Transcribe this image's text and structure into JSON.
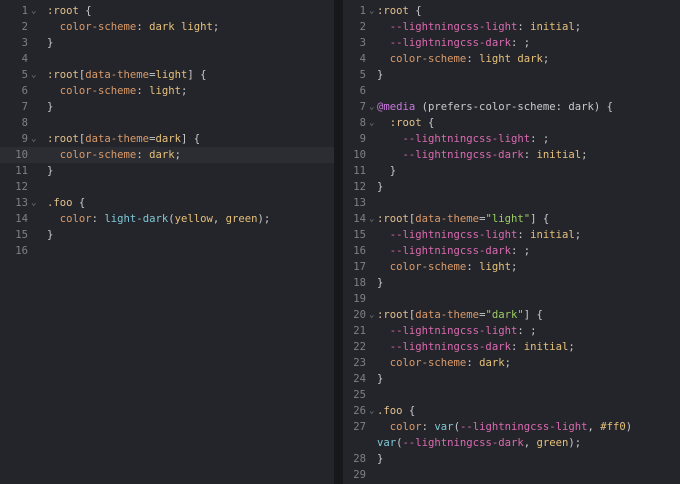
{
  "colors": {
    "background": "#24252a",
    "selector": "#e2c08d",
    "property": "#d99a6a",
    "value": "#e5c07b",
    "function": "#7fc7d7",
    "variable": "#d96ab0",
    "string": "#9ccc65",
    "at_rule": "#c678dd"
  },
  "left": {
    "lines": [
      {
        "n": "1",
        "fold": true,
        "indent": 0,
        "tokens": [
          [
            "sel",
            ":root"
          ],
          [
            "punc",
            " {"
          ]
        ]
      },
      {
        "n": "2",
        "indent": 2,
        "tokens": [
          [
            "prop",
            "color-scheme"
          ],
          [
            "punc",
            ": "
          ],
          [
            "val",
            "dark light"
          ],
          [
            "punc",
            ";"
          ]
        ]
      },
      {
        "n": "3",
        "indent": 0,
        "tokens": [
          [
            "punc",
            "}"
          ]
        ]
      },
      {
        "n": "4",
        "indent": 0,
        "tokens": []
      },
      {
        "n": "5",
        "fold": true,
        "indent": 0,
        "tokens": [
          [
            "sel",
            ":root"
          ],
          [
            "punc",
            "["
          ],
          [
            "prop",
            "data-theme"
          ],
          [
            "punc",
            "="
          ],
          [
            "val",
            "light"
          ],
          [
            "punc",
            "] {"
          ]
        ]
      },
      {
        "n": "6",
        "indent": 2,
        "tokens": [
          [
            "prop",
            "color-scheme"
          ],
          [
            "punc",
            ": "
          ],
          [
            "val",
            "light"
          ],
          [
            "punc",
            ";"
          ]
        ]
      },
      {
        "n": "7",
        "indent": 0,
        "tokens": [
          [
            "punc",
            "}"
          ]
        ]
      },
      {
        "n": "8",
        "indent": 0,
        "tokens": []
      },
      {
        "n": "9",
        "fold": true,
        "indent": 0,
        "tokens": [
          [
            "sel",
            ":root"
          ],
          [
            "punc",
            "["
          ],
          [
            "prop",
            "data-theme"
          ],
          [
            "punc",
            "="
          ],
          [
            "val",
            "dark"
          ],
          [
            "punc",
            "] {"
          ]
        ]
      },
      {
        "n": "10",
        "indent": 2,
        "highlight": true,
        "tokens": [
          [
            "prop",
            "color-scheme"
          ],
          [
            "punc",
            ": "
          ],
          [
            "val",
            "dark"
          ],
          [
            "punc",
            ";"
          ]
        ]
      },
      {
        "n": "11",
        "indent": 0,
        "tokens": [
          [
            "punc",
            "}"
          ]
        ]
      },
      {
        "n": "12",
        "indent": 0,
        "tokens": []
      },
      {
        "n": "13",
        "fold": true,
        "indent": 0,
        "tokens": [
          [
            "sel",
            ".foo"
          ],
          [
            "punc",
            " {"
          ]
        ]
      },
      {
        "n": "14",
        "indent": 2,
        "tokens": [
          [
            "prop",
            "color"
          ],
          [
            "punc",
            ": "
          ],
          [
            "func",
            "light-dark"
          ],
          [
            "punc",
            "("
          ],
          [
            "val",
            "yellow"
          ],
          [
            "punc",
            ", "
          ],
          [
            "val",
            "green"
          ],
          [
            "punc",
            ");"
          ]
        ]
      },
      {
        "n": "15",
        "indent": 0,
        "tokens": [
          [
            "punc",
            "}"
          ]
        ]
      },
      {
        "n": "16",
        "indent": 0,
        "tokens": []
      }
    ]
  },
  "right": {
    "lines": [
      {
        "n": "1",
        "fold": true,
        "indent": 0,
        "tokens": [
          [
            "sel",
            ":root"
          ],
          [
            "punc",
            " {"
          ]
        ]
      },
      {
        "n": "2",
        "indent": 2,
        "tokens": [
          [
            "var",
            "--lightningcss-light"
          ],
          [
            "punc",
            ": "
          ],
          [
            "val",
            "initial"
          ],
          [
            "punc",
            ";"
          ]
        ]
      },
      {
        "n": "3",
        "indent": 2,
        "tokens": [
          [
            "var",
            "--lightningcss-dark"
          ],
          [
            "punc",
            ": ;"
          ]
        ]
      },
      {
        "n": "4",
        "indent": 2,
        "tokens": [
          [
            "prop",
            "color-scheme"
          ],
          [
            "punc",
            ": "
          ],
          [
            "val",
            "light dark"
          ],
          [
            "punc",
            ";"
          ]
        ]
      },
      {
        "n": "5",
        "indent": 0,
        "tokens": [
          [
            "punc",
            "}"
          ]
        ]
      },
      {
        "n": "6",
        "indent": 0,
        "tokens": []
      },
      {
        "n": "7",
        "fold": true,
        "indent": 0,
        "tokens": [
          [
            "at",
            "@media"
          ],
          [
            "punc",
            " (prefers-color-scheme: dark) {"
          ]
        ]
      },
      {
        "n": "8",
        "fold": true,
        "indent": 2,
        "tokens": [
          [
            "sel",
            ":root"
          ],
          [
            "punc",
            " {"
          ]
        ]
      },
      {
        "n": "9",
        "indent": 4,
        "tokens": [
          [
            "var",
            "--lightningcss-light"
          ],
          [
            "punc",
            ": ;"
          ]
        ]
      },
      {
        "n": "10",
        "indent": 4,
        "tokens": [
          [
            "var",
            "--lightningcss-dark"
          ],
          [
            "punc",
            ": "
          ],
          [
            "val",
            "initial"
          ],
          [
            "punc",
            ";"
          ]
        ]
      },
      {
        "n": "11",
        "indent": 2,
        "tokens": [
          [
            "punc",
            "}"
          ]
        ]
      },
      {
        "n": "12",
        "indent": 0,
        "tokens": [
          [
            "punc",
            "}"
          ]
        ]
      },
      {
        "n": "13",
        "indent": 0,
        "tokens": []
      },
      {
        "n": "14",
        "fold": true,
        "indent": 0,
        "tokens": [
          [
            "sel",
            ":root"
          ],
          [
            "punc",
            "["
          ],
          [
            "prop",
            "data-theme"
          ],
          [
            "punc",
            "="
          ],
          [
            "str",
            "\"light\""
          ],
          [
            "punc",
            "] {"
          ]
        ]
      },
      {
        "n": "15",
        "indent": 2,
        "tokens": [
          [
            "var",
            "--lightningcss-light"
          ],
          [
            "punc",
            ": "
          ],
          [
            "val",
            "initial"
          ],
          [
            "punc",
            ";"
          ]
        ]
      },
      {
        "n": "16",
        "indent": 2,
        "tokens": [
          [
            "var",
            "--lightningcss-dark"
          ],
          [
            "punc",
            ": ;"
          ]
        ]
      },
      {
        "n": "17",
        "indent": 2,
        "tokens": [
          [
            "prop",
            "color-scheme"
          ],
          [
            "punc",
            ": "
          ],
          [
            "val",
            "light"
          ],
          [
            "punc",
            ";"
          ]
        ]
      },
      {
        "n": "18",
        "indent": 0,
        "tokens": [
          [
            "punc",
            "}"
          ]
        ]
      },
      {
        "n": "19",
        "indent": 0,
        "tokens": []
      },
      {
        "n": "20",
        "fold": true,
        "indent": 0,
        "tokens": [
          [
            "sel",
            ":root"
          ],
          [
            "punc",
            "["
          ],
          [
            "prop",
            "data-theme"
          ],
          [
            "punc",
            "="
          ],
          [
            "str",
            "\"dark\""
          ],
          [
            "punc",
            "] {"
          ]
        ]
      },
      {
        "n": "21",
        "indent": 2,
        "tokens": [
          [
            "var",
            "--lightningcss-light"
          ],
          [
            "punc",
            ": ;"
          ]
        ]
      },
      {
        "n": "22",
        "indent": 2,
        "tokens": [
          [
            "var",
            "--lightningcss-dark"
          ],
          [
            "punc",
            ": "
          ],
          [
            "val",
            "initial"
          ],
          [
            "punc",
            ";"
          ]
        ]
      },
      {
        "n": "23",
        "indent": 2,
        "tokens": [
          [
            "prop",
            "color-scheme"
          ],
          [
            "punc",
            ": "
          ],
          [
            "val",
            "dark"
          ],
          [
            "punc",
            ";"
          ]
        ]
      },
      {
        "n": "24",
        "indent": 0,
        "tokens": [
          [
            "punc",
            "}"
          ]
        ]
      },
      {
        "n": "25",
        "indent": 0,
        "tokens": []
      },
      {
        "n": "26",
        "fold": true,
        "indent": 0,
        "tokens": [
          [
            "sel",
            ".foo"
          ],
          [
            "punc",
            " {"
          ]
        ]
      },
      {
        "n": "27",
        "indent": 2,
        "tokens": [
          [
            "prop",
            "color"
          ],
          [
            "punc",
            ": "
          ],
          [
            "func",
            "var"
          ],
          [
            "punc",
            "("
          ],
          [
            "var",
            "--lightningcss-light"
          ],
          [
            "punc",
            ", "
          ],
          [
            "val",
            "#ff0"
          ],
          [
            "punc",
            ")"
          ]
        ]
      },
      {
        "n": "",
        "indent": 0,
        "tokens": [
          [
            "func",
            "var"
          ],
          [
            "punc",
            "("
          ],
          [
            "var",
            "--lightningcss-dark"
          ],
          [
            "punc",
            ", "
          ],
          [
            "val",
            "green"
          ],
          [
            "punc",
            ");"
          ]
        ]
      },
      {
        "n": "28",
        "indent": 0,
        "tokens": [
          [
            "punc",
            "}"
          ]
        ]
      },
      {
        "n": "29",
        "indent": 0,
        "tokens": []
      }
    ]
  }
}
